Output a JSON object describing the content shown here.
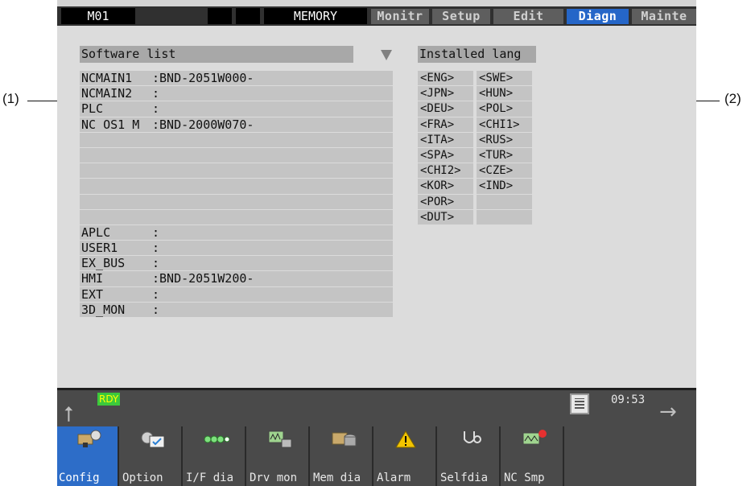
{
  "header": {
    "mode": "M01",
    "status": "MEMORY",
    "tabs": [
      {
        "label": "Monitr",
        "active": false
      },
      {
        "label": "Setup",
        "active": false
      },
      {
        "label": "Edit",
        "active": false
      },
      {
        "label": "Diagn",
        "active": true
      },
      {
        "label": "Mainte",
        "active": false
      }
    ]
  },
  "software": {
    "title": "Software list",
    "rows": [
      {
        "name": "NCMAIN1",
        "value": ":BND-2051W000-"
      },
      {
        "name": "NCMAIN2",
        "value": ":"
      },
      {
        "name": "PLC",
        "value": ":"
      },
      {
        "name": "NC OS1 M",
        "value": ":BND-2000W070-"
      },
      {
        "name": "",
        "value": ""
      },
      {
        "name": "",
        "value": ""
      },
      {
        "name": "",
        "value": ""
      },
      {
        "name": "",
        "value": ""
      },
      {
        "name": "",
        "value": ""
      },
      {
        "name": "",
        "value": ""
      },
      {
        "name": "APLC",
        "value": ":"
      },
      {
        "name": "USER1",
        "value": ":"
      },
      {
        "name": "EX_BUS",
        "value": ":"
      },
      {
        "name": "HMI",
        "value": ":BND-2051W200-"
      },
      {
        "name": "EXT",
        "value": ":"
      },
      {
        "name": "3D_MON",
        "value": ":"
      }
    ]
  },
  "languages": {
    "title": "Installed lang",
    "rows": [
      [
        "<ENG>",
        "<SWE>"
      ],
      [
        "<JPN>",
        "<HUN>"
      ],
      [
        "<DEU>",
        "<POL>"
      ],
      [
        "<FRA>",
        "<CHI1>"
      ],
      [
        "<ITA>",
        "<RUS>"
      ],
      [
        "<SPA>",
        "<TUR>"
      ],
      [
        "<CHI2>",
        "<CZE>"
      ],
      [
        "<KOR>",
        "<IND>"
      ],
      [
        "<POR>",
        ""
      ],
      [
        "<DUT>",
        ""
      ]
    ]
  },
  "status_bar": {
    "rdy": "RDY",
    "time": "09:53"
  },
  "menu": [
    {
      "label": "Config",
      "icon": "config-icon",
      "active": true
    },
    {
      "label": "Option",
      "icon": "option-icon",
      "active": false
    },
    {
      "label": "I/F dia",
      "icon": "if-diagnosis-icon",
      "active": false
    },
    {
      "label": "Drv mon",
      "icon": "drive-monitor-icon",
      "active": false
    },
    {
      "label": "Mem dia",
      "icon": "memory-diagnosis-icon",
      "active": false
    },
    {
      "label": "Alarm",
      "icon": "alarm-icon",
      "active": false
    },
    {
      "label": "Selfdia",
      "icon": "stethoscope-icon",
      "active": false
    },
    {
      "label": "NC Smp",
      "icon": "nc-sampling-icon",
      "active": false
    }
  ],
  "annotations": {
    "left": "(1)",
    "right": "(2)"
  },
  "colors": {
    "active_tab": "#2566c8",
    "active_menu": "#2d6dc8",
    "rdy_badge": "#3cc93c"
  }
}
